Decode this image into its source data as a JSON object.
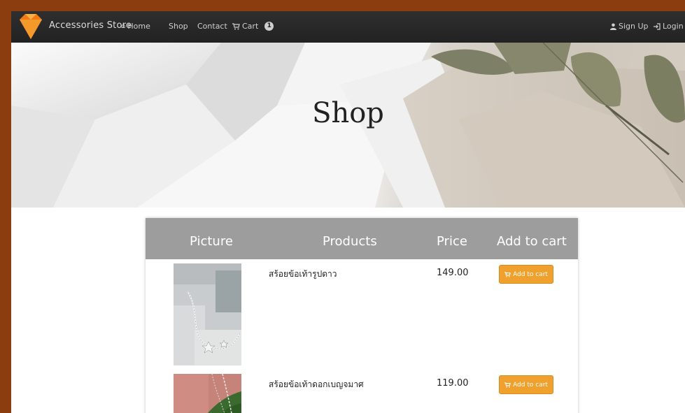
{
  "navbar": {
    "brand": "Accessories Store",
    "items": [
      {
        "label": "Home",
        "icon": "home-icon"
      },
      {
        "label": "Shop"
      },
      {
        "label": "Contact"
      },
      {
        "label": "Cart",
        "icon": "cart-icon",
        "badge": "1"
      }
    ],
    "right_items": [
      {
        "label": "Sign Up",
        "icon": "user-icon"
      },
      {
        "label": "Login",
        "icon": "login-icon"
      }
    ]
  },
  "hero": {
    "title": "Shop"
  },
  "table": {
    "headers": [
      "Picture",
      "Products",
      "Price",
      "Add to cart"
    ],
    "rows": [
      {
        "product": "สร้อยข้อเท้ารูปดาว",
        "price": "149.00",
        "button": "Add to cart"
      },
      {
        "product": "สร้อยข้อเท้าดอกเบญจมาศ",
        "price": "119.00",
        "button": "Add to cart"
      }
    ]
  },
  "colors": {
    "navbar_bg": "#2a2a2a",
    "frame_border": "#8b3d10",
    "table_header": "#9d9d9d",
    "button_accent": "#f0a02c"
  }
}
